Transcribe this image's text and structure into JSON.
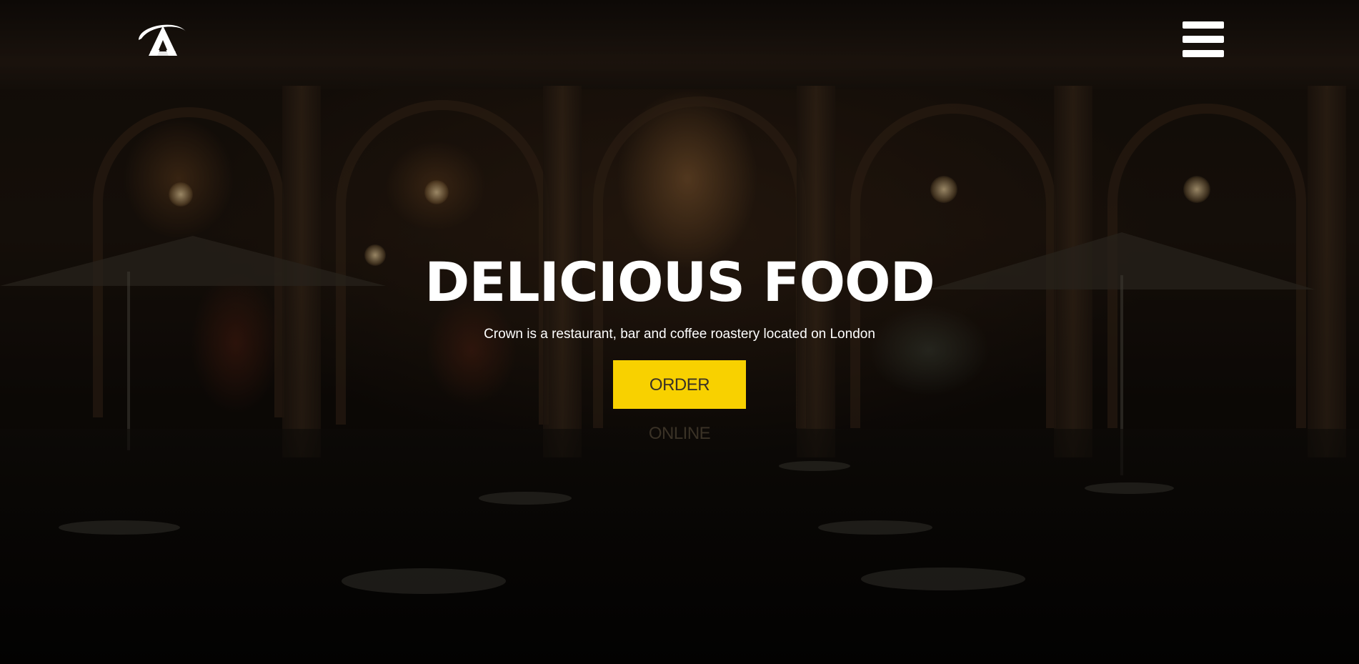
{
  "header": {
    "logo_icon": "crown-a-logo-icon",
    "menu_icon": "hamburger-menu-icon"
  },
  "hero": {
    "title": "DELICIOUS FOOD",
    "subtitle": "Crown is a restaurant, bar and coffee roastery located on London",
    "cta_label": "ORDER ONLINE"
  },
  "colors": {
    "accent": "#f8d100",
    "text": "#ffffff",
    "cta_text": "#3a3226"
  }
}
